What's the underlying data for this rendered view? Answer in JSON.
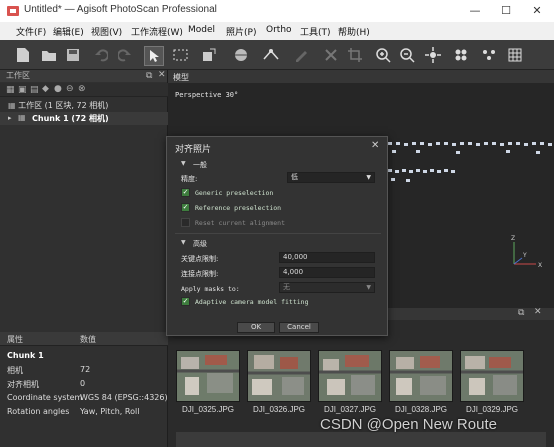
{
  "window": {
    "title": "Untitled* — Agisoft PhotoScan Professional"
  },
  "menu": [
    "文件(F)",
    "编辑(E)",
    "视图(V)",
    "工作流程(W)",
    "Model",
    "照片(P)",
    "Ortho",
    "工具(T)",
    "帮助(H)"
  ],
  "workspace": {
    "header": "工作区",
    "root": "工作区 (1 区块, 72 相机)",
    "chunk": "Chunk 1 (72 相机)"
  },
  "properties": {
    "col_name": "属性",
    "col_value": "数值",
    "section": "Chunk 1",
    "rows": [
      {
        "name": "相机",
        "value": "72"
      },
      {
        "name": "对齐相机",
        "value": "0"
      },
      {
        "name": "Coordinate system",
        "value": "WGS 84 (EPSG::4326)"
      },
      {
        "name": "Rotation angles",
        "value": "Yaw, Pitch, Roll"
      }
    ]
  },
  "model": {
    "tab": "模型",
    "perspective": "Perspective 30°"
  },
  "dialog": {
    "title": "对齐照片",
    "section_general": "一般",
    "accuracy_label": "精度:",
    "accuracy_value": "低",
    "generic_label": "Generic preselection",
    "generic_checked": true,
    "reference_label": "Reference preselection",
    "reference_checked": true,
    "reset_label": "Reset current alignment",
    "reset_checked": false,
    "section_advanced": "高级",
    "keypoint_label": "关键点限制:",
    "keypoint_value": "40,000",
    "tiepoint_label": "连接点限制:",
    "tiepoint_value": "4,000",
    "masks_label": "Apply masks to:",
    "masks_value": "无",
    "adaptive_label": "Adaptive camera model fitting",
    "adaptive_checked": true,
    "ok": "OK",
    "cancel": "Cancel"
  },
  "photos": [
    "DJI_0325.JPG",
    "DJI_0326.JPG",
    "DJI_0327.JPG",
    "DJI_0328.JPG",
    "DJI_0329.JPG"
  ],
  "watermark": "CSDN @Open New Route",
  "colors": {
    "check": "#3e7d3e",
    "panel": "#303030",
    "dialog": "#333333"
  }
}
